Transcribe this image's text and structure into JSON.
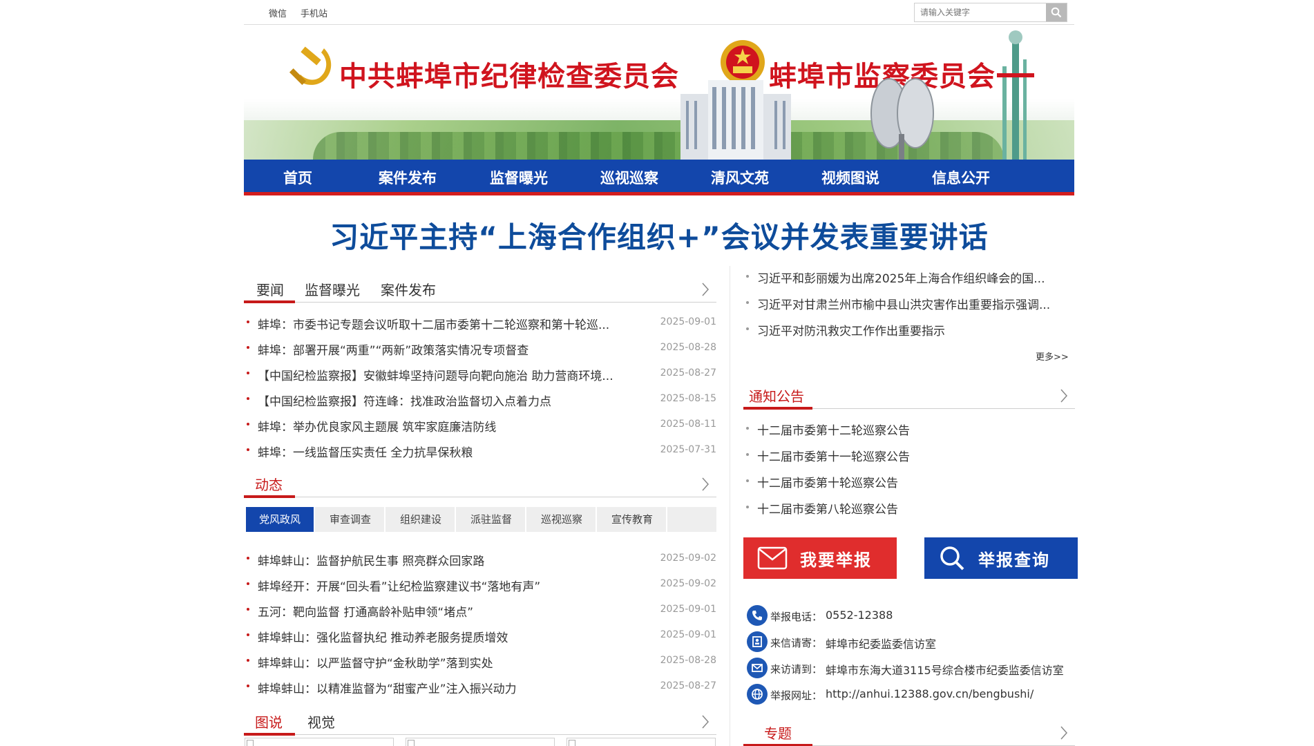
{
  "topbar": {
    "links": [
      "微信",
      "手机站"
    ],
    "search_placeholder": "请输入关键字"
  },
  "banner": {
    "title_left": "中共蚌埠市纪律检查委员会",
    "title_right": "蚌埠市监察委员会"
  },
  "nav": {
    "items": [
      "首页",
      "案件发布",
      "监督曝光",
      "巡视巡察",
      "清风文苑",
      "视频图说",
      "信息公开"
    ]
  },
  "headline": "习近平主持“上海合作组织+”会议并发表重要讲话",
  "news_section": {
    "tabs": [
      "要闻",
      "监督曝光",
      "案件发布"
    ],
    "items": [
      {
        "title": "蚌埠：市委书记专题会议听取十二届市委第十二轮巡察和第十轮巡...",
        "date": "2025-09-01"
      },
      {
        "title": "蚌埠：部署开展“两重”“两新”政策落实情况专项督查",
        "date": "2025-08-28"
      },
      {
        "title": "【中国纪检监察报】安徽蚌埠坚持问题导向靶向施治 助力营商环境...",
        "date": "2025-08-27"
      },
      {
        "title": "【中国纪检监察报】符连峰：找准政治监督切入点着力点",
        "date": "2025-08-15"
      },
      {
        "title": "蚌埠：举办优良家风主题展 筑牢家庭廉洁防线",
        "date": "2025-08-11"
      },
      {
        "title": "蚌埠：一线监督压实责任 全力抗旱保秋粮",
        "date": "2025-07-31"
      }
    ]
  },
  "dynamics_section": {
    "title": "动态",
    "subtabs": [
      "党风政风",
      "审查调查",
      "组织建设",
      "派驻监督",
      "巡视巡察",
      "宣传教育"
    ],
    "items": [
      {
        "title": "蚌埠蚌山：监督护航民生事 照亮群众回家路",
        "date": "2025-09-02"
      },
      {
        "title": "蚌埠经开：开展“回头看”让纪检监察建议书“落地有声”",
        "date": "2025-09-02"
      },
      {
        "title": "五河：靶向监督 打通高龄补贴申领“堵点”",
        "date": "2025-09-01"
      },
      {
        "title": "蚌埠蚌山：强化监督执纪 推动养老服务提质增效",
        "date": "2025-09-01"
      },
      {
        "title": "蚌埠蚌山：以严监督守护“金秋助学”落到实处",
        "date": "2025-08-28"
      },
      {
        "title": "蚌埠蚌山：以精准监督为“甜蜜产业”注入振兴动力",
        "date": "2025-08-27"
      }
    ]
  },
  "picture_section": {
    "tabs": [
      "图说",
      "视觉"
    ]
  },
  "right_news": {
    "items": [
      "习近平和彭丽媛为出席2025年上海合作组织峰会的国...",
      "习近平对甘肃兰州市榆中县山洪灾害作出重要指示强调...",
      "习近平对防汛救灾工作作出重要指示"
    ],
    "more": "更多>>"
  },
  "notice_section": {
    "title": "通知公告",
    "items": [
      "十二届市委第十二轮巡察公告",
      "十二届市委第十一轮巡察公告",
      "十二届市委第十轮巡察公告",
      "十二届市委第八轮巡察公告"
    ]
  },
  "report_buttons": {
    "report": "我要举报",
    "query": "举报查询"
  },
  "contact": {
    "phone_label": "举报电话：",
    "phone": "0552-12388",
    "letter_label": "来信请寄：",
    "letter": "蚌埠市纪委监委信访室",
    "visit_label": "来访请到：",
    "visit": "蚌埠市东海大道3115号综合楼市纪委监委信访室",
    "web_label": "举报网址：",
    "web": "http://anhui.12388.gov.cn/bengbushi/"
  },
  "special_section": {
    "title": "专题"
  },
  "colors": {
    "nav_blue": "#1346ac",
    "accent_red": "#c71a1a",
    "headline_blue": "#0e4c9b",
    "report_red": "#e02d2d",
    "query_blue": "#1346ac"
  }
}
